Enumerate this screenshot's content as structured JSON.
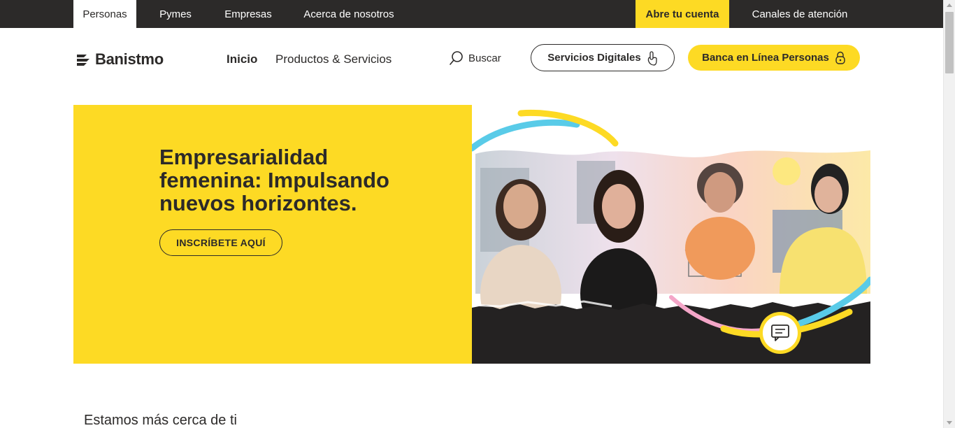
{
  "topbar": {
    "tabs": [
      "Personas",
      "Pymes",
      "Empresas",
      "Acerca de nosotros"
    ],
    "open_account": "Abre tu cuenta",
    "channels": "Canales de atención"
  },
  "header": {
    "logo_text": "Banistmo",
    "nav": [
      "Inicio",
      "Productos & Servicios"
    ],
    "search_label": "Buscar",
    "digital_services_label": "Servicios Digitales",
    "online_banking_label": "Banca en Línea Personas"
  },
  "hero": {
    "title": "Empresarialidad femenina: Impulsando nuevos horizontes.",
    "cta_label": "INSCRÍBETE AQUÍ"
  },
  "section": {
    "title": "Estamos más cerca de ti"
  },
  "colors": {
    "brand_yellow": "#fdda24",
    "dark": "#2c2a29",
    "accent_blue": "#59cbe8",
    "accent_pink": "#f4a6c8"
  },
  "icons": [
    "banistmo-logo-icon",
    "search-icon",
    "touch-icon",
    "lock-icon",
    "chat-icon"
  ]
}
